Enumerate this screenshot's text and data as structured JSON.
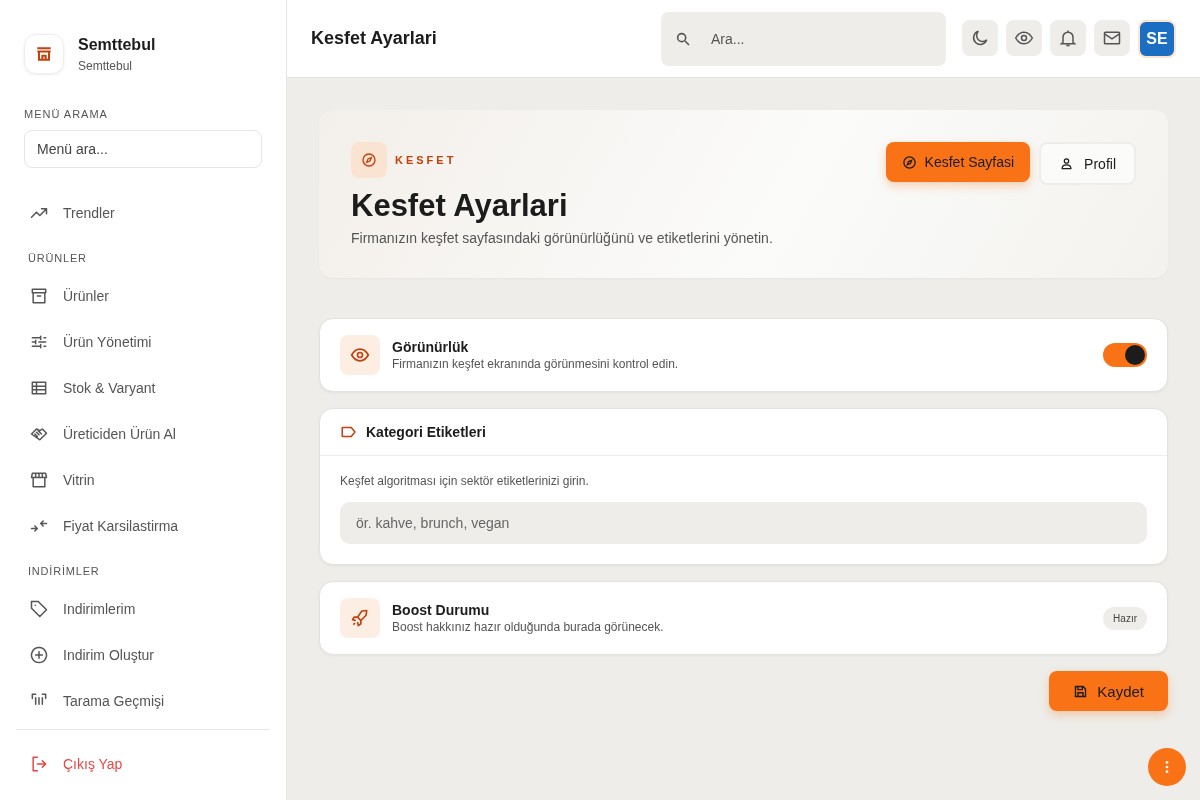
{
  "brand": {
    "name": "Semttebul",
    "subtitle": "Semttebul"
  },
  "menu_search": {
    "label": "MENÜ ARAMA",
    "placeholder": "Menü ara..."
  },
  "nav": [
    {
      "kind": "item",
      "label": "Trendler"
    },
    {
      "kind": "section",
      "label": "ÜRÜNLER"
    },
    {
      "kind": "item",
      "label": "Ürünler"
    },
    {
      "kind": "item",
      "label": "Ürün Yönetimi"
    },
    {
      "kind": "item",
      "label": "Stok & Varyant"
    },
    {
      "kind": "item",
      "label": "Üreticiden Ürün Al"
    },
    {
      "kind": "item",
      "label": "Vitrin"
    },
    {
      "kind": "item",
      "label": "Fiyat Karsilastirma"
    },
    {
      "kind": "section",
      "label": "INDİRİMLER"
    },
    {
      "kind": "item",
      "label": "Indirimlerim"
    },
    {
      "kind": "item",
      "label": "Indirim Oluştur"
    },
    {
      "kind": "item",
      "label": "Tarama Geçmişi"
    }
  ],
  "logout": "Çıkış Yap",
  "header": {
    "title": "Kesfet Ayarlari",
    "search_placeholder": "Ara...",
    "avatar": "SE"
  },
  "hero": {
    "eyebrow": "KESFET",
    "title": "Kesfet Ayarlari",
    "description": "Firmanızın keşfet sayfasındaki görünürlüğünü ve etiketlerini yönetin.",
    "primary_button": "Kesfet Sayfasi",
    "secondary_button": "Profil"
  },
  "visibility": {
    "title": "Görünürlük",
    "description": "Firmanızın keşfet ekranında görünmesini kontrol edin.",
    "on": true
  },
  "tags": {
    "title": "Kategori Etiketleri",
    "hint": "Keşfet algoritması için sektör etiketlerinizi girin.",
    "placeholder": "ör. kahve, brunch, vegan"
  },
  "boost": {
    "title": "Boost Durumu",
    "description": "Boost hakkınız hazır olduğunda burada görünecek.",
    "status": "Hazır"
  },
  "save_button": "Kaydet"
}
